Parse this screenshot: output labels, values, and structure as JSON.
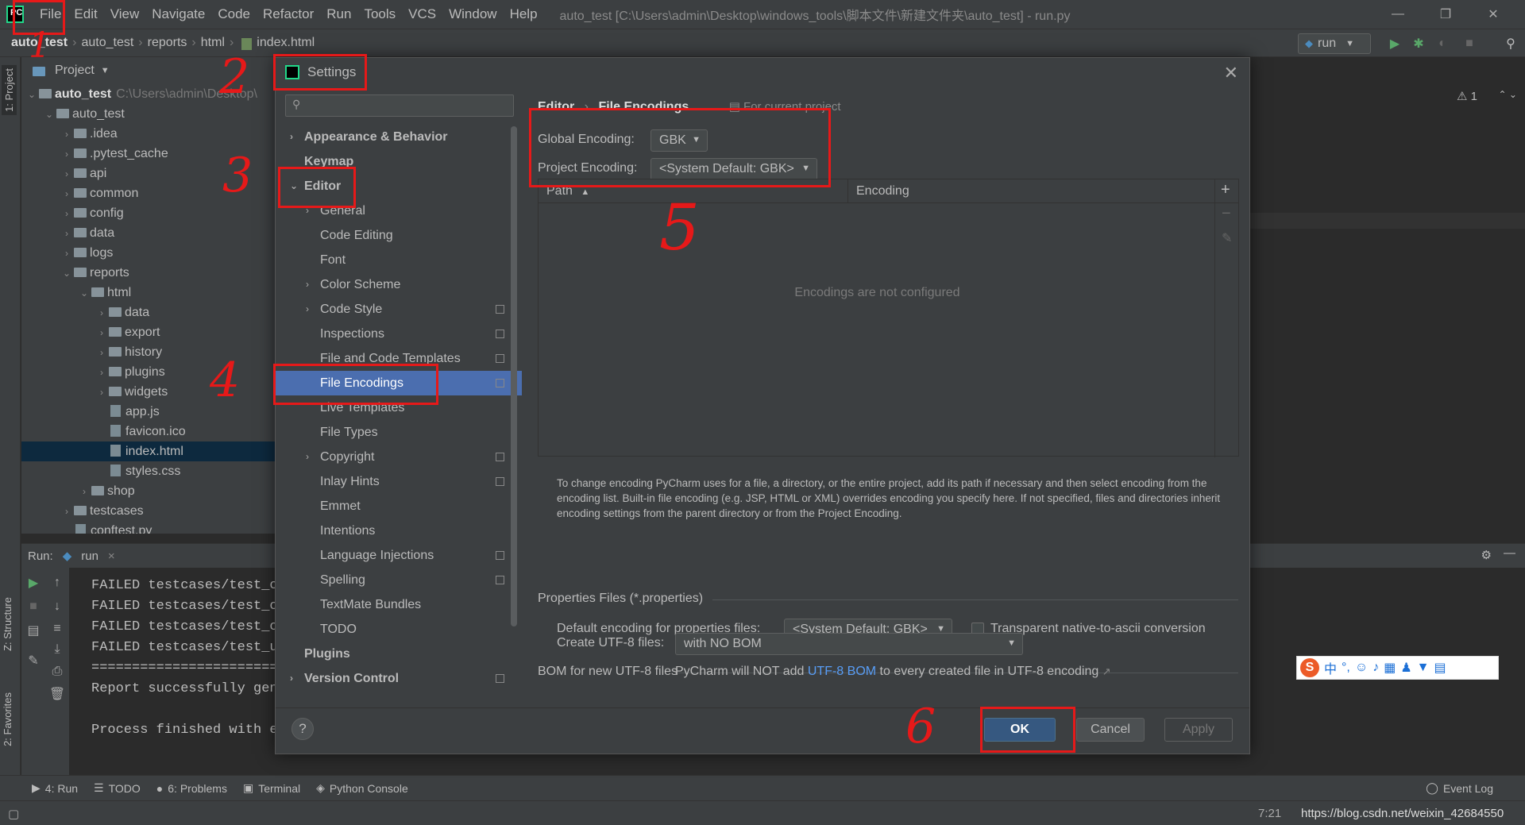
{
  "window": {
    "title": "auto_test [C:\\Users\\admin\\Desktop\\windows_tools\\脚本文件\\新建文件夹\\auto_test] - run.py"
  },
  "menu": [
    "File",
    "Edit",
    "View",
    "Navigate",
    "Code",
    "Refactor",
    "Run",
    "Tools",
    "VCS",
    "Window",
    "Help"
  ],
  "breadcrumb": [
    "auto_test",
    "auto_test",
    "reports",
    "html",
    "index.html"
  ],
  "run_config": "run",
  "editor": {
    "problems_count": "1"
  },
  "left_tabs": [
    "1: Project",
    "Z: Structure",
    "2: Favorites"
  ],
  "project": {
    "header": "Project",
    "root_name": "auto_test",
    "root_path": "C:\\Users\\admin\\Desktop\\",
    "tree": [
      {
        "label": "auto_test",
        "depth": 1,
        "kind": "folder",
        "open": true
      },
      {
        "label": ".idea",
        "depth": 2,
        "kind": "folder"
      },
      {
        "label": ".pytest_cache",
        "depth": 2,
        "kind": "folder"
      },
      {
        "label": "api",
        "depth": 2,
        "kind": "folder"
      },
      {
        "label": "common",
        "depth": 2,
        "kind": "folder"
      },
      {
        "label": "config",
        "depth": 2,
        "kind": "folder"
      },
      {
        "label": "data",
        "depth": 2,
        "kind": "folder"
      },
      {
        "label": "logs",
        "depth": 2,
        "kind": "folder"
      },
      {
        "label": "reports",
        "depth": 2,
        "kind": "folder",
        "open": true
      },
      {
        "label": "html",
        "depth": 3,
        "kind": "folder",
        "open": true
      },
      {
        "label": "data",
        "depth": 4,
        "kind": "folder"
      },
      {
        "label": "export",
        "depth": 4,
        "kind": "folder"
      },
      {
        "label": "history",
        "depth": 4,
        "kind": "folder"
      },
      {
        "label": "plugins",
        "depth": 4,
        "kind": "folder"
      },
      {
        "label": "widgets",
        "depth": 4,
        "kind": "folder"
      },
      {
        "label": "app.js",
        "depth": 4,
        "kind": "file"
      },
      {
        "label": "favicon.ico",
        "depth": 4,
        "kind": "file"
      },
      {
        "label": "index.html",
        "depth": 4,
        "kind": "file",
        "selected": true
      },
      {
        "label": "styles.css",
        "depth": 4,
        "kind": "file"
      },
      {
        "label": "shop",
        "depth": 3,
        "kind": "folder"
      },
      {
        "label": "testcases",
        "depth": 2,
        "kind": "folder"
      },
      {
        "label": "conftest.py",
        "depth": 2,
        "kind": "file"
      }
    ]
  },
  "run": {
    "label": "Run:",
    "tab": "run",
    "output": [
      "FAILED testcases/test_c",
      "FAILED testcases/test_c",
      "FAILED testcases/test_c",
      "FAILED testcases/test_u",
      "========================",
      "Report successfully gen",
      "",
      "Process finished with e"
    ]
  },
  "settings": {
    "title": "Settings",
    "search_placeholder": "",
    "tree": [
      {
        "label": "Appearance & Behavior",
        "level": 0,
        "expander": "›"
      },
      {
        "label": "Keymap",
        "level": 0
      },
      {
        "label": "Editor",
        "level": 0,
        "expander": "⌄"
      },
      {
        "label": "General",
        "level": 1,
        "expander": "›"
      },
      {
        "label": "Code Editing",
        "level": 1
      },
      {
        "label": "Font",
        "level": 1
      },
      {
        "label": "Color Scheme",
        "level": 1,
        "expander": "›"
      },
      {
        "label": "Code Style",
        "level": 1,
        "expander": "›",
        "project": true
      },
      {
        "label": "Inspections",
        "level": 1,
        "project": true
      },
      {
        "label": "File and Code Templates",
        "level": 1,
        "project": true
      },
      {
        "label": "File Encodings",
        "level": 1,
        "project": true,
        "selected": true
      },
      {
        "label": "Live Templates",
        "level": 1
      },
      {
        "label": "File Types",
        "level": 1
      },
      {
        "label": "Copyright",
        "level": 1,
        "expander": "›",
        "project": true
      },
      {
        "label": "Inlay Hints",
        "level": 1,
        "project": true
      },
      {
        "label": "Emmet",
        "level": 1
      },
      {
        "label": "Intentions",
        "level": 1
      },
      {
        "label": "Language Injections",
        "level": 1,
        "project": true
      },
      {
        "label": "Spelling",
        "level": 1,
        "project": true
      },
      {
        "label": "TextMate Bundles",
        "level": 1
      },
      {
        "label": "TODO",
        "level": 1
      },
      {
        "label": "Plugins",
        "level": 0
      },
      {
        "label": "Version Control",
        "level": 0,
        "expander": "›",
        "project": true
      }
    ],
    "page": {
      "crumb_parent": "Editor",
      "crumb_current": "File Encodings",
      "scope_note": "For current project",
      "global_label": "Global Encoding:",
      "global_value": "GBK",
      "project_label": "Project Encoding:",
      "project_value": "<System Default: GBK>",
      "col_path": "Path",
      "col_encoding": "Encoding",
      "empty_text": "Encodings are not configured",
      "help_text": "To change encoding PyCharm uses for a file, a directory, or the entire project, add its path if necessary and then select encoding from the encoding list. Built-in file encoding (e.g. JSP, HTML or XML) overrides encoding you specify here. If not specified, files and directories inherit encoding settings from the parent directory or from the Project Encoding.",
      "props_section": "Properties Files (*.properties)",
      "props_label": "Default encoding for properties files:",
      "props_value": "<System Default: GBK>",
      "native_label": "Transparent native-to-ascii conversion",
      "bom_section": "BOM for new UTF-8 files",
      "bom_label": "Create UTF-8 files:",
      "bom_value": "with NO BOM",
      "bom_note_pre": "PyCharm will NOT add",
      "bom_note_link": "UTF-8 BOM",
      "bom_note_post": "to every created file in UTF-8 encoding"
    },
    "buttons": {
      "help": "?",
      "ok": "OK",
      "cancel": "Cancel",
      "apply": "Apply"
    }
  },
  "bottom_tools": [
    "4: Run",
    "TODO",
    "6: Problems",
    "Terminal",
    "Python Console"
  ],
  "event_log": "Event Log",
  "status": {
    "position": "7:21",
    "url": "https://blog.csdn.net/weixin_42684550"
  },
  "annotations": [
    "1",
    "2",
    "3",
    "4",
    "5",
    "6"
  ],
  "colors": {
    "accent_selection": "#4b6eaf",
    "annotation": "#e61919",
    "ok_button": "#365880"
  }
}
